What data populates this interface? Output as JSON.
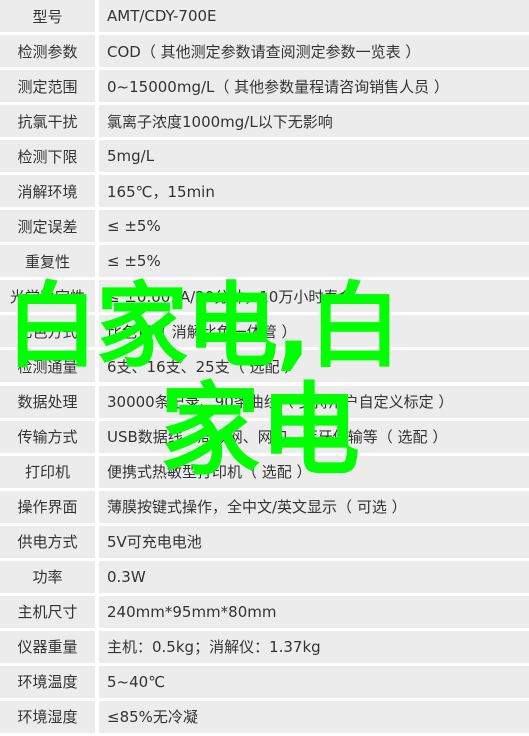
{
  "specs": [
    {
      "label": "型号",
      "value": "AMT/CDY-700E"
    },
    {
      "label": "检测参数",
      "value": "COD（ 其他测定参数请查阅测定参数一览表 ）"
    },
    {
      "label": "测定范围",
      "value": "0~15000mg/L（ 其他参数量程请咨询销售人员 ）"
    },
    {
      "label": "抗氯干扰",
      "value": "氯离子浓度1000mg/L以下无影响"
    },
    {
      "label": "检测下限",
      "value": "5mg/L"
    },
    {
      "label": "消解环境",
      "value": "165℃，15min"
    },
    {
      "label": "测定误差",
      "value": "≤ ±5%"
    },
    {
      "label": "重复性",
      "value": "≤ ±5%"
    },
    {
      "label": "光学稳定性",
      "value": "≤ ±0.001A/20分钟，10万小时寿命"
    },
    {
      "label": "比色方式",
      "value": "比色管（ 消解比色一体管 ）"
    },
    {
      "label": "检测通量",
      "value": "6支、16支、25支（ 选配 ）"
    },
    {
      "label": "数据处理",
      "value": "30000条记录、90条曲线（ 支持用户自定义标定 ）"
    },
    {
      "label": "传输方式",
      "value": "USB数据线、局域网、网口、蓝牙传输等（ 选配 ）"
    },
    {
      "label": "打印机",
      "value": "便携式热敏型打印机（ 选配 ）"
    },
    {
      "label": "操作界面",
      "value": "薄膜按键式操作，全中文/英文显示（ 可选 ）"
    },
    {
      "label": "供电方式",
      "value": "5V可充电电池"
    },
    {
      "label": "功率",
      "value": "0.3W"
    },
    {
      "label": "主机尺寸",
      "value": "240mm*95mm*80mm"
    },
    {
      "label": "仪器重量",
      "value": "主机：0.5kg；消解仪：1.37kg"
    },
    {
      "label": "环境温度",
      "value": "5~40℃"
    },
    {
      "label": "环境湿度",
      "value": "≤85%无冷凝"
    }
  ],
  "watermark": {
    "line1": "白家电,白",
    "line2": "家电",
    "color": "#00ff00"
  }
}
